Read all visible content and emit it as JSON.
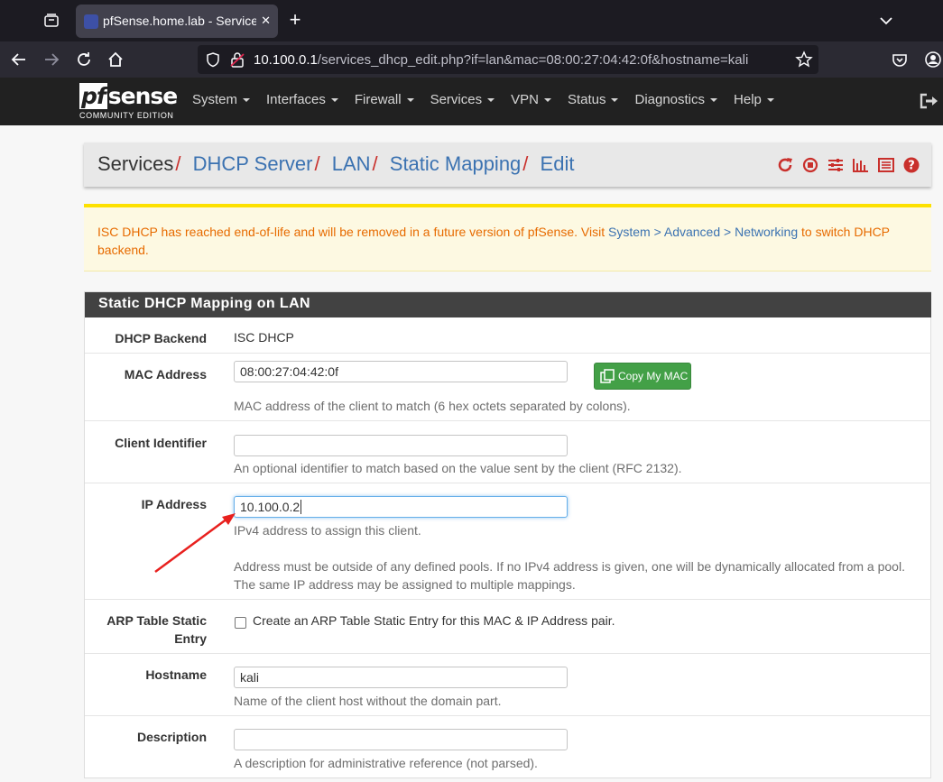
{
  "browser": {
    "tab_title": "pfSense.home.lab - Services: DHCP",
    "tab_close_glyph": "✕",
    "new_tab_glyph": "+",
    "url_host": "10.100.0.1",
    "url_path": "/services_dhcp_edit.php?if=lan&mac=08:00:27:04:42:0f&hostname=kali",
    "icons": [
      "tab-list-icon",
      "firefox-view-icon",
      "chevron-down-icon",
      "back-arrow-icon",
      "forward-arrow-icon",
      "reload-icon",
      "home-icon",
      "shield-icon",
      "insecure-lock-icon",
      "bookmark-star-icon",
      "pocket-icon",
      "account-icon"
    ]
  },
  "pfsense": {
    "logo_pf": "pf",
    "logo_sense": "sense",
    "logo_edition": "COMMUNITY EDITION",
    "menu": [
      "System",
      "Interfaces",
      "Firewall",
      "Services",
      "VPN",
      "Status",
      "Diagnostics",
      "Help"
    ]
  },
  "breadcrumb": {
    "root": "Services",
    "items": [
      "DHCP Server",
      "LAN",
      "Static Mapping",
      "Edit"
    ],
    "separator": "/",
    "icons": [
      "reload-icon",
      "stop-icon",
      "sliders-icon",
      "chart-icon",
      "list-icon",
      "help-icon"
    ]
  },
  "alert": {
    "text_before": "ISC DHCP has reached end-of-life and will be removed in a future version of pfSense. Visit ",
    "link": "System > Advanced > Networking",
    "text_after": " to switch DHCP backend."
  },
  "panel": {
    "title": "Static DHCP Mapping on LAN",
    "dhcp_backend": {
      "label": "DHCP Backend",
      "value": "ISC DHCP"
    },
    "mac_address": {
      "label": "MAC Address",
      "value": "08:00:27:04:42:0f",
      "button": "Copy My MAC",
      "help": "MAC address of the client to match (6 hex octets separated by colons)."
    },
    "client_identifier": {
      "label": "Client Identifier",
      "value": "",
      "help": "An optional identifier to match based on the value sent by the client (RFC 2132)."
    },
    "ip_address": {
      "label": "IP Address",
      "value": "10.100.0.2",
      "help1": "IPv4 address to assign this client.",
      "help2": "Address must be outside of any defined pools. If no IPv4 address is given, one will be dynamically allocated from a pool.",
      "help3": "The same IP address may be assigned to multiple mappings."
    },
    "arp_static": {
      "label_line1": "ARP Table Static",
      "label_line2": "Entry",
      "checkbox_label": "Create an ARP Table Static Entry for this MAC & IP Address pair.",
      "checked": false
    },
    "hostname": {
      "label": "Hostname",
      "value": "kali",
      "help": "Name of the client host without the domain part."
    },
    "description": {
      "label": "Description",
      "value": "",
      "help": "A description for administrative reference (not parsed)."
    }
  },
  "colors": {
    "link": "#3b72b1",
    "separator": "#c9302c",
    "alert_text": "#e76b00",
    "copy_button": "#43a047",
    "annotation_arrow": "#e8201e"
  }
}
